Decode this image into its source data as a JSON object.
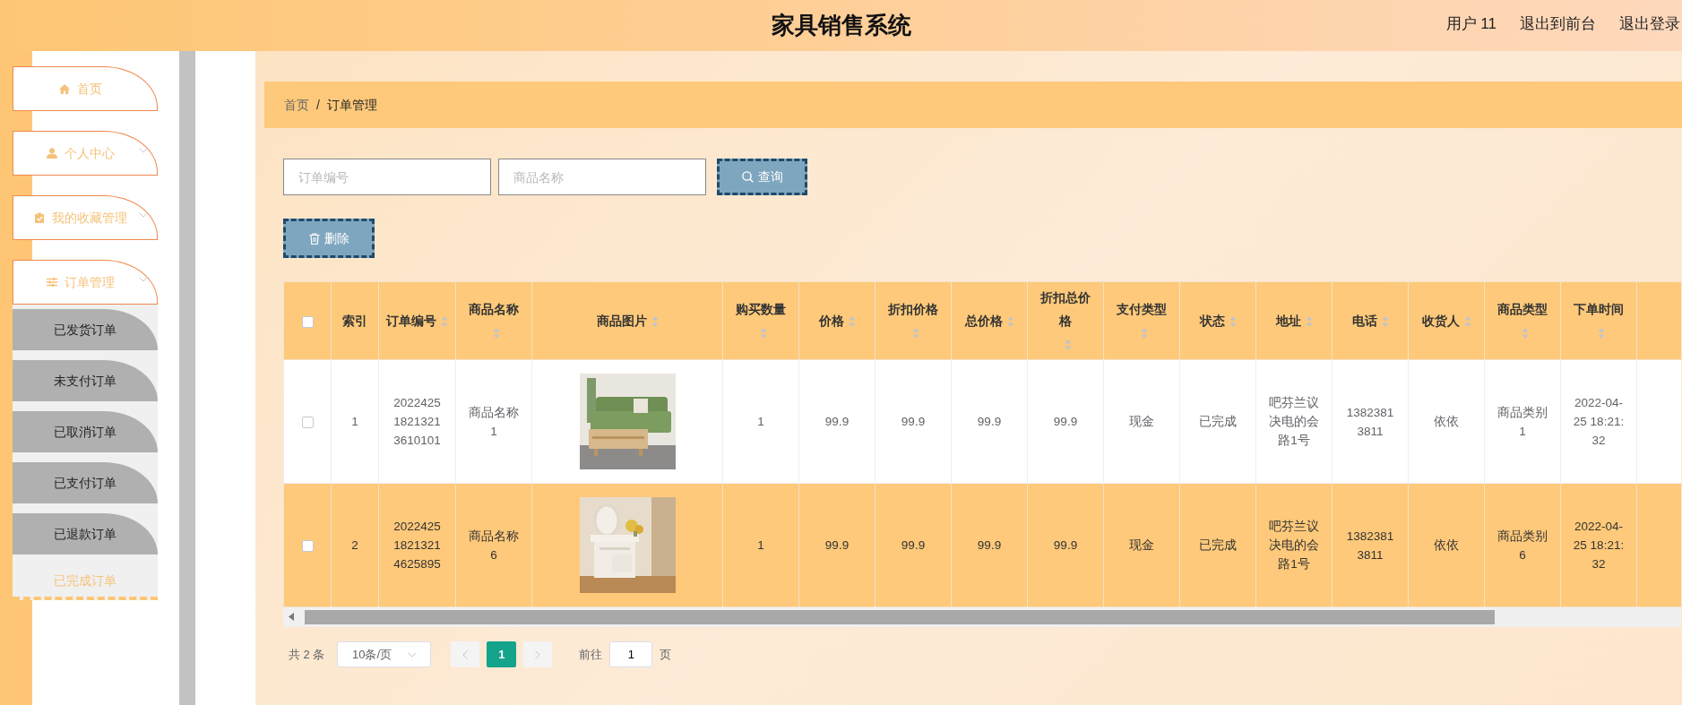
{
  "header": {
    "title": "家具销售系统",
    "links": [
      {
        "label": "用户 11"
      },
      {
        "label": "退出到前台"
      },
      {
        "label": "退出登录"
      }
    ]
  },
  "sidebar": {
    "items": [
      {
        "label": "首页",
        "expandable": false
      },
      {
        "label": "个人中心",
        "expandable": true
      },
      {
        "label": "我的收藏管理",
        "expandable": true
      },
      {
        "label": "订单管理",
        "expandable": true,
        "children": [
          {
            "label": "已发货订单",
            "selected": false
          },
          {
            "label": "未支付订单",
            "selected": false
          },
          {
            "label": "已取消订单",
            "selected": false
          },
          {
            "label": "已支付订单",
            "selected": false
          },
          {
            "label": "已退款订单",
            "selected": false
          },
          {
            "label": "已完成订单",
            "selected": true
          }
        ]
      }
    ]
  },
  "breadcrumb": {
    "items": [
      "首页",
      "订单管理"
    ],
    "separator": "/"
  },
  "search": {
    "fields": [
      {
        "placeholder": "订单编号"
      },
      {
        "placeholder": "商品名称"
      }
    ],
    "button": "查询"
  },
  "delete_button": "删除",
  "table": {
    "select_all": {
      "checked": false
    },
    "columns": [
      {
        "label": "索引",
        "sortable": false
      },
      {
        "label": "订单编号",
        "sortable": true
      },
      {
        "label": "商品名称",
        "sortable": true
      },
      {
        "label": "商品图片",
        "sortable": true
      },
      {
        "label": "购买数量",
        "sortable": true
      },
      {
        "label": "价格",
        "sortable": true
      },
      {
        "label": "折扣价格",
        "sortable": true
      },
      {
        "label": "总价格",
        "sortable": true
      },
      {
        "label": "折扣总价格",
        "sortable": true
      },
      {
        "label": "支付类型",
        "sortable": true
      },
      {
        "label": "状态",
        "sortable": true
      },
      {
        "label": "地址",
        "sortable": true
      },
      {
        "label": "电话",
        "sortable": true
      },
      {
        "label": "收货人",
        "sortable": true
      },
      {
        "label": "商品类型",
        "sortable": true
      },
      {
        "label": "下单时间",
        "sortable": true
      }
    ],
    "rows": [
      {
        "checked": false,
        "highlighted": false,
        "cells": [
          "1",
          "202242518213213610101",
          "商品名称1",
          {
            "kind": "picture"
          },
          "1",
          "99.9",
          "99.9",
          "99.9",
          "99.9",
          "现金",
          "已完成",
          "吧芬兰议决电的会路1号",
          "13823813811",
          "依依",
          "商品类别1",
          "2022-04-25 18:21:32"
        ]
      },
      {
        "checked": false,
        "highlighted": true,
        "cells": [
          "2",
          "202242518213214625895",
          "商品名称6",
          {
            "kind": "picture"
          },
          "1",
          "99.9",
          "99.9",
          "99.9",
          "99.9",
          "现金",
          "已完成",
          "吧芬兰议决电的会路1号",
          "13823813811",
          "依依",
          "商品类别6",
          "2022-04-25 18:21:32"
        ]
      }
    ]
  },
  "pagination": {
    "total": "共 2 条",
    "page_size": "10条/页",
    "pages": [
      {
        "label": "1",
        "selected": true
      }
    ],
    "goto_label": "前往",
    "goto_value": "1",
    "page_suffix": "页"
  }
}
